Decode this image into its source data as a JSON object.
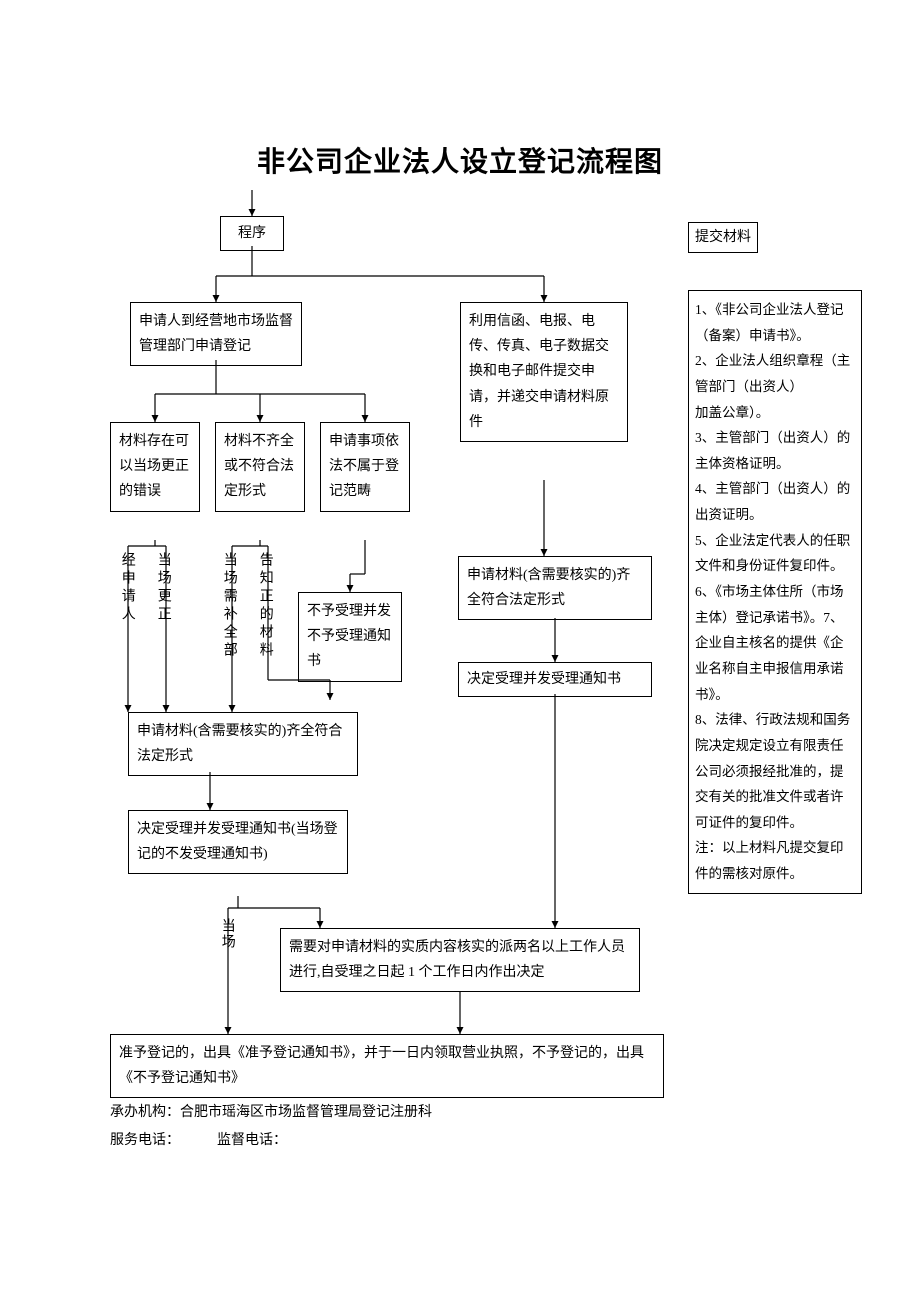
{
  "title": "非公司企业法人设立登记流程图",
  "nodes": {
    "start": "程序",
    "apply_onsite": "申请人到经营地市场监督管理部门申请登记",
    "apply_remote": "利用信函、电报、电传、传真、电子数据交换和电子邮件提交申请，并递交申请材料原件",
    "mat_err": "材料存在可以当场更正的错误",
    "mat_incomplete": "材料不齐全或不符合法定形式",
    "not_in_scope": "申请事项依法不属于登记范畴",
    "path_a": "经申请人",
    "path_b": "当场更正",
    "path_c": "当场需补全部",
    "path_d": "告知正的材料",
    "reject_notice": "不予受理并发不予受理通知书",
    "complete_right": "申请材料(含需要核实的)齐全符合法定形式",
    "accept_right": "决定受理并发受理通知书",
    "complete_left": "申请材料(含需要核实的)齐全符合法定形式",
    "accept_left": "决定受理并发受理通知书(当场登记的不发受理通知书)",
    "path_onspot": "当场",
    "verify": "需要对申请材料的实质内容核实的派两名以上工作人员进行,自受理之日起 1 个工作日内作出决定",
    "final": "准予登记的，出具《准予登记通知书》，并于一日内领取营业执照，不予登记的，出具《不予登记通知书》"
  },
  "materials_header": "提交材料",
  "materials_body": "1、《非公司企业法人登记（备案）申请书》。\n2、企业法人组织章程（主管部门（出资人）\n加盖公章）。\n3、主管部门（出资人）的主体资格证明。\n4、主管部门（出资人）的出资证明。\n5、企业法定代表人的任职文件和身份证件复印件。\n6、《市场主体住所（市场主体）登记承诺书》。7、企业自主核名的提供《企业名称自主申报信用承诺书》。\n8、法律、行政法规和国务院决定规定设立有限责任公司必须报经批准的，提交有关的批准文件或者许可证件的复印件。\n注：以上材料凡提交复印件的需核对原件。",
  "footer1": "承办机构：合肥市瑶海区市场监督管理局登记注册科",
  "footer2_label1": "服务电话：",
  "footer2_label2": "监督电话："
}
